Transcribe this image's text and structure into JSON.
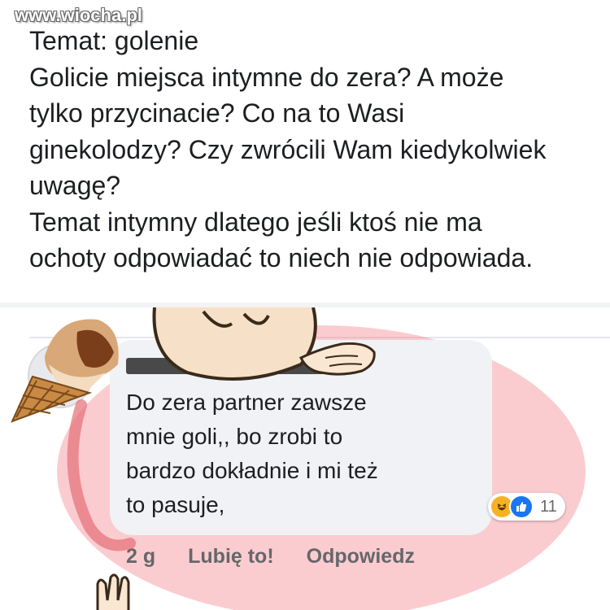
{
  "watermark": "www.wiocha.pl",
  "post": {
    "lines": [
      "Temat: golenie",
      "Golicie miejsca intymne do zera?  A może",
      "tylko przycinacie? Co na to Wasi",
      "ginekolodzy? Czy zwrócili Wam kiedykolwiek",
      "uwagę?",
      "Temat intymny dlatego jeśli ktoś nie ma",
      "ochoty odpowiadać to niech nie odpowiada."
    ]
  },
  "comment": {
    "lines": [
      "Do zera partner zawsze",
      "mnie goli,, bo zrobi to",
      "bardzo dokładnie i mi też",
      "to pasuje,"
    ],
    "reactions": {
      "icons": [
        "haha-icon",
        "like-icon"
      ],
      "count": "11"
    },
    "actions": {
      "time": "2 g",
      "like": "Lubię to!",
      "reply": "Odpowiedz"
    }
  },
  "colors": {
    "text": "#1c1e21",
    "muted": "#65676b",
    "bubble": "#f0f2f5",
    "highlight": "#f47882",
    "like_blue": "#1877f2",
    "haha_yellow": "#f7b125"
  }
}
